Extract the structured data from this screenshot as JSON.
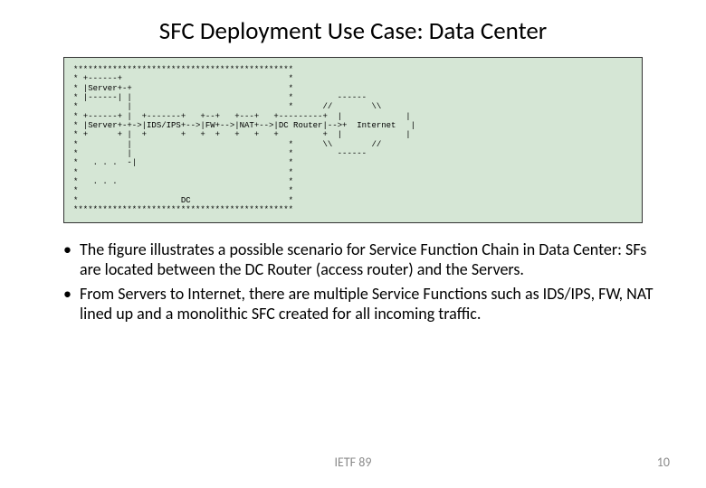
{
  "title": "SFC Deployment Use Case: Data Center",
  "diagram": "*********************************************\n* +------+                                  *\n* |Server+-+                                *\n* |------| |                                *         ------\n*          |                                *      //        \\\\\n* +------+ |  +-------+   +--+   +---+   +---------+  |             |\n* |Server+-+->|IDS/IPS+-->|FW+-->|NAT+-->|DC Router|-->+  Internet   |\n* +      + |  +       +   +  +   +   +   +         +  |             |\n*          |                                *      \\\\        //\n*          |                                *         ------\n*   . . .  -|                               *\n*                                           *\n*   . . .                                   *\n*                                           *\n*                     DC                    *\n*********************************************",
  "bullets": [
    "The figure illustrates a possible scenario for Service Function Chain in Data Center: SFs are located between the DC Router (access router) and the Servers.",
    "From Servers to Internet, there are multiple Service Functions such as IDS/IPS, FW, NAT lined up and a monolithic SFC created for all incoming traffic."
  ],
  "footer": {
    "center": "IETF 89",
    "page": "10"
  }
}
